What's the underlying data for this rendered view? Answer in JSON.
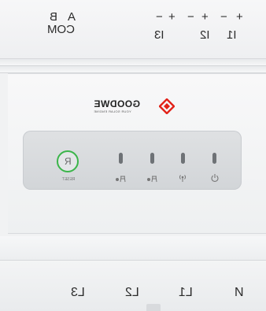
{
  "top": {
    "rs485_a": "A",
    "rs485_b": "B",
    "com": "COM",
    "i3_minus": "−",
    "i3_plus": "+",
    "i3_label": "I3",
    "i2_minus": "−",
    "i2_plus": "+",
    "i2_label": "I2",
    "i1_minus": "−",
    "i1_plus": "+",
    "i1_label": "I1"
  },
  "brand": {
    "name": "GOODWE",
    "slogan": "YOUR SOLAR ENGINE",
    "accent_color": "#e2231a"
  },
  "panel": {
    "reset_glyph": "R",
    "reset_label": "RESET",
    "reset_ring_color": "#3bb54a",
    "led_icons": [
      "grid-export-icon",
      "grid-import-icon",
      "communication-icon",
      "power-icon"
    ]
  },
  "bottom": {
    "l3": "L3",
    "l2": "L2",
    "l1": "L1",
    "n": "N"
  }
}
